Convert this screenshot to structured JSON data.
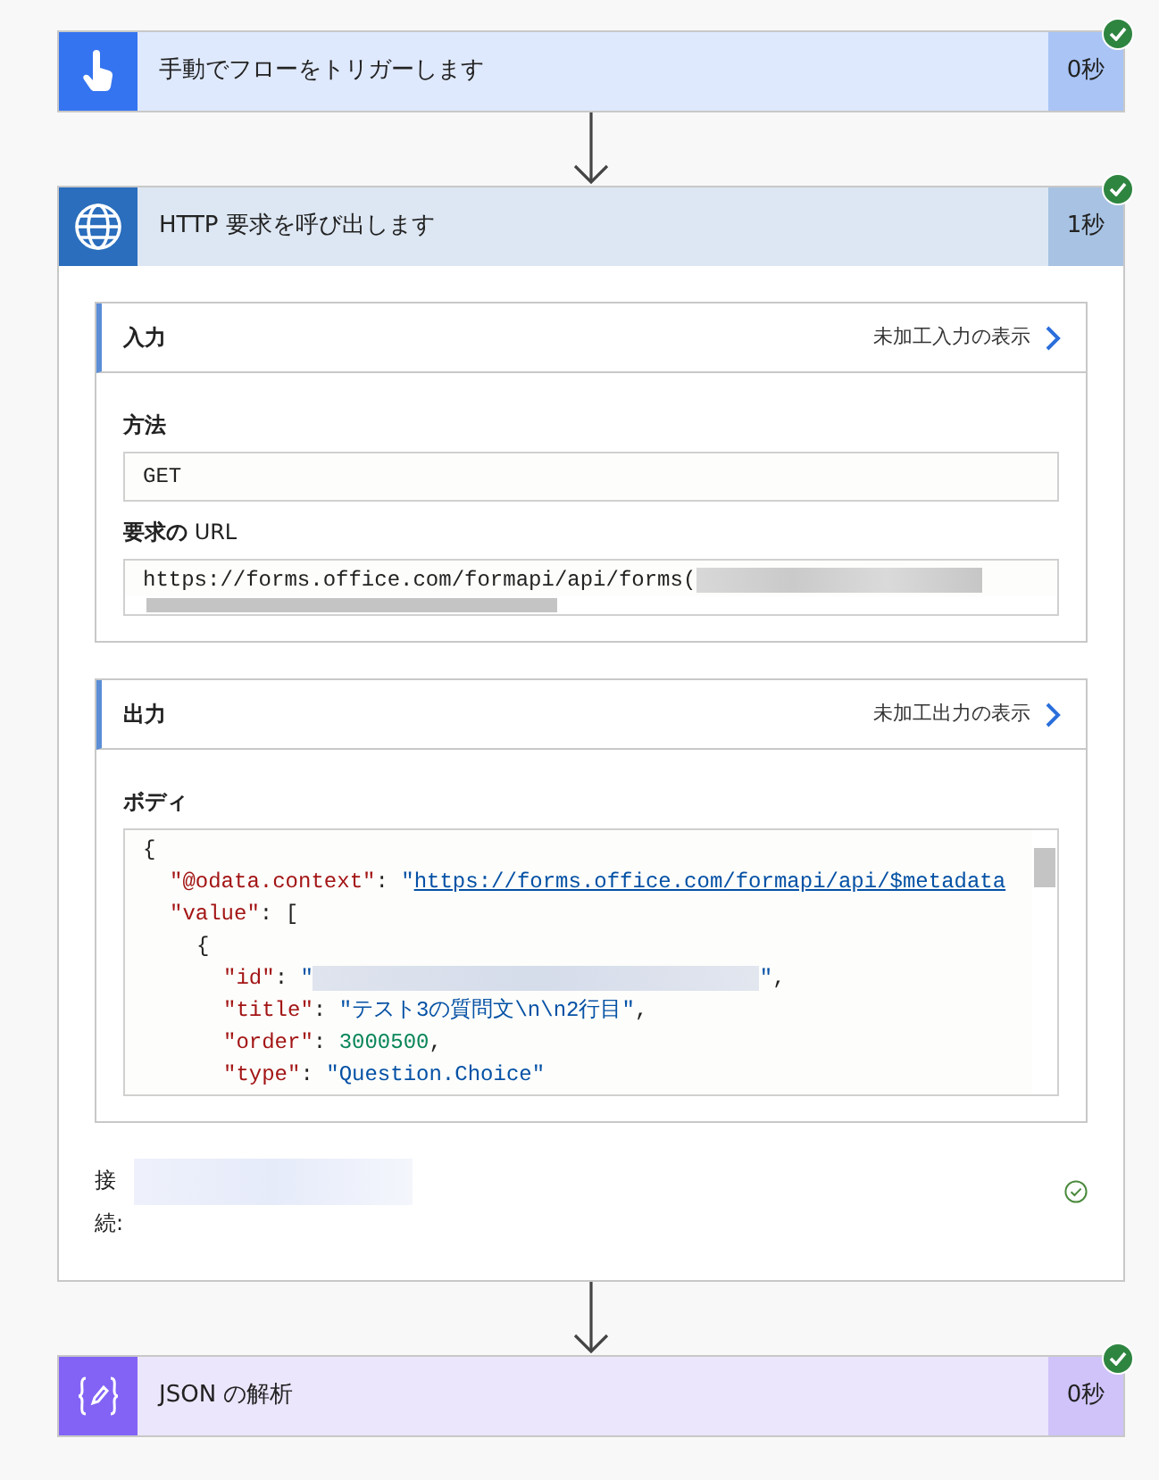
{
  "steps": [
    {
      "kind": "trigger",
      "title": "手動でフローをトリガーします",
      "duration": "0秒",
      "succeeded": true
    },
    {
      "kind": "http",
      "title": "HTTP 要求を呼び出します",
      "duration": "1秒",
      "succeeded": true,
      "sections": [
        {
          "title": "入力",
          "link": "未加工入力の表示",
          "fields": [
            {
              "kind": "text",
              "label": "方法",
              "value": "GET"
            },
            {
              "kind": "url",
              "label": "**要求の** URL",
              "value": "https://forms.office.com/formapi/api/forms(",
              "redacted": true
            }
          ]
        },
        {
          "title": "出力",
          "link": "未加工出力の表示",
          "fields": [
            {
              "kind": "code",
              "label": "ボディ",
              "lines": [
                {
                  "tokens": [
                    {
                      "kind": "punct",
                      "text": "{"
                    }
                  ],
                  "children": [
                    {
                      "tokens": [
                        {
                          "kind": "key",
                          "text": "\"@odata.context\""
                        },
                        {
                          "kind": "punct",
                          "text": ": "
                        },
                        {
                          "kind": "string",
                          "text": "\""
                        },
                        {
                          "kind": "link",
                          "text": "https://forms.office.com/formapi/api/$metadata"
                        }
                      ]
                    },
                    {
                      "tokens": [
                        {
                          "kind": "key",
                          "text": "\"value\""
                        },
                        {
                          "kind": "punct",
                          "text": ": ["
                        }
                      ],
                      "children": [
                        {
                          "tokens": [
                            {
                              "kind": "punct",
                              "text": "{"
                            }
                          ],
                          "children": [
                            {
                              "tokens": [
                                {
                                  "kind": "key",
                                  "text": "\"id\""
                                },
                                {
                                  "kind": "punct",
                                  "text": ": "
                                },
                                {
                                  "kind": "string",
                                  "text": "\""
                                },
                                {
                                  "kind": "redacted"
                                },
                                {
                                  "kind": "string",
                                  "text": "\""
                                },
                                {
                                  "kind": "punct",
                                  "text": ","
                                }
                              ]
                            },
                            {
                              "tokens": [
                                {
                                  "kind": "key",
                                  "text": "\"title\""
                                },
                                {
                                  "kind": "punct",
                                  "text": ": "
                                },
                                {
                                  "kind": "string",
                                  "text": "\"テスト3の質問文\\n\\n2行目\""
                                },
                                {
                                  "kind": "punct",
                                  "text": ","
                                }
                              ]
                            },
                            {
                              "tokens": [
                                {
                                  "kind": "key",
                                  "text": "\"order\""
                                },
                                {
                                  "kind": "punct",
                                  "text": ": "
                                },
                                {
                                  "kind": "number",
                                  "text": "3000500"
                                },
                                {
                                  "kind": "punct",
                                  "text": ","
                                }
                              ]
                            },
                            {
                              "tokens": [
                                {
                                  "kind": "key",
                                  "text": "\"type\""
                                },
                                {
                                  "kind": "punct",
                                  "text": ": "
                                },
                                {
                                  "kind": "string",
                                  "text": "\"Question.Choice\""
                                }
                              ]
                            }
                          ]
                        }
                      ]
                    }
                  ]
                }
              ]
            }
          ]
        }
      ],
      "connection": {
        "label": "接続:",
        "redacted": true,
        "verified": true
      }
    },
    {
      "kind": "parse-json",
      "title": "JSON の解析",
      "duration": "0秒",
      "succeeded": true
    }
  ]
}
